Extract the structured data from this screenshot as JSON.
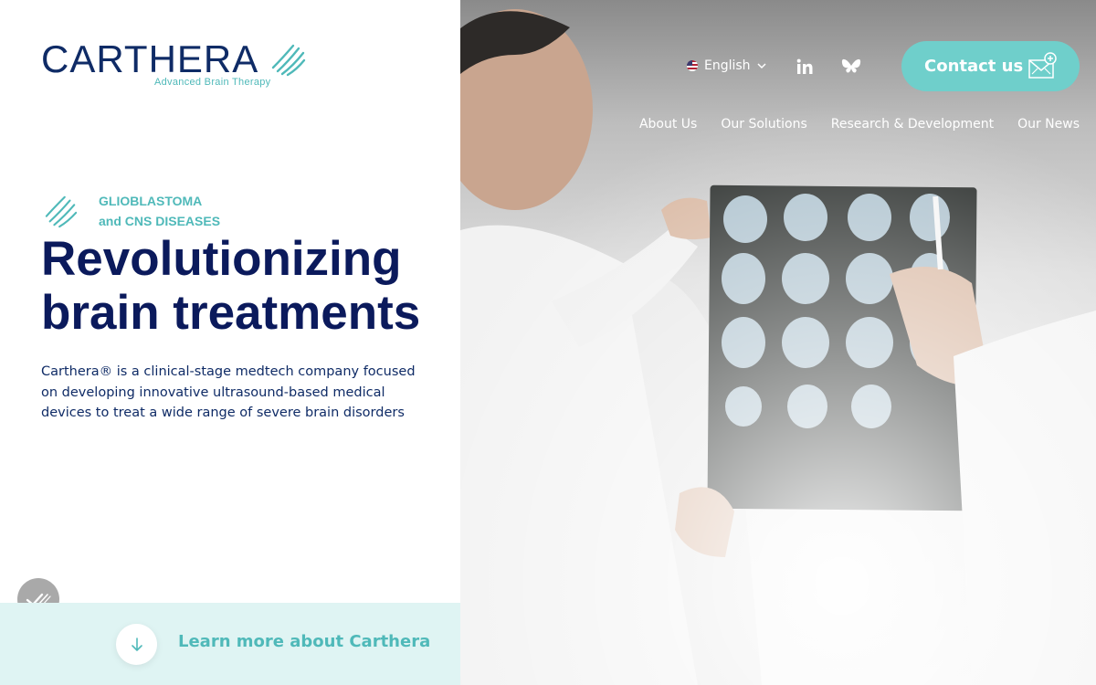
{
  "brand": {
    "name": "CARTHERA",
    "tagline": "Advanced Brain Therapy"
  },
  "hero": {
    "eyebrow_line1": "GLIOBLASTOMA",
    "eyebrow_line2": "and CNS DISEASES",
    "title_line1": "Revolutionizing",
    "title_line2": "brain treatments",
    "description": "Carthera® is a clinical-stage medtech company focused on developing innovative ultrasound-based medical devices to treat a wide range of severe brain disorders"
  },
  "cta": {
    "learn_more": "Learn more about Carthera",
    "contact": "Contact us"
  },
  "header": {
    "language": "English",
    "social": [
      "linkedin-icon",
      "bluesky-icon"
    ]
  },
  "nav": {
    "items": [
      "About Us",
      "Our Solutions",
      "Research & Development",
      "Our News"
    ]
  },
  "colors": {
    "navy": "#0b1a5c",
    "teal": "#4fb9b9",
    "teal_button": "#6fcfcb",
    "light_teal_bg": "#dff4f3"
  }
}
